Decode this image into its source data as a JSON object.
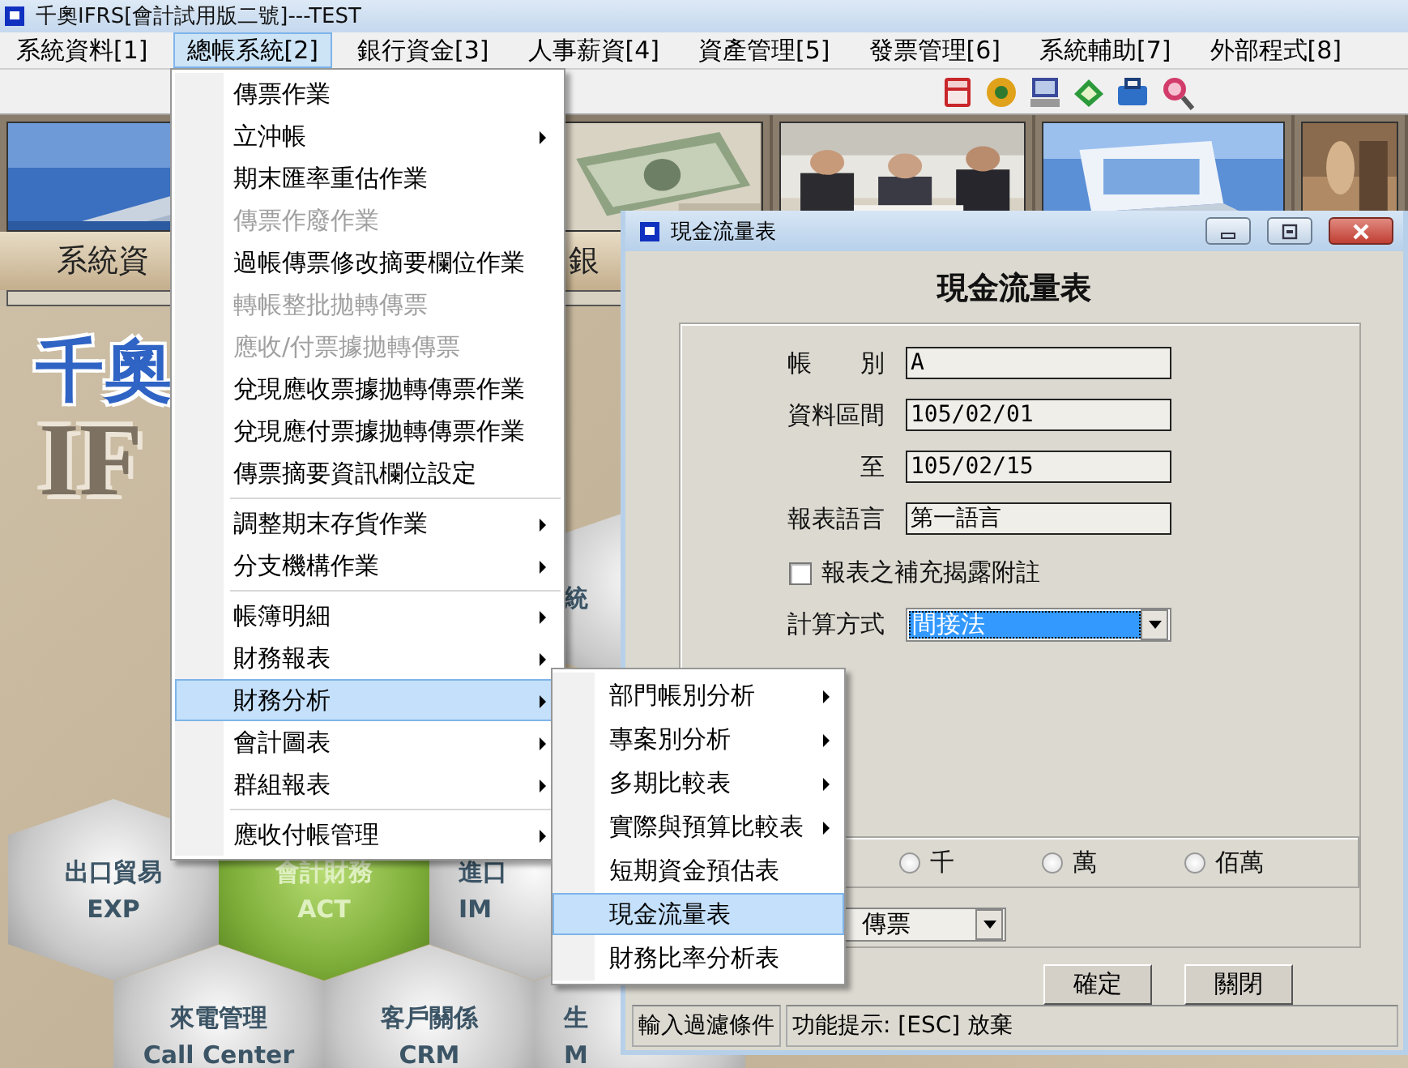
{
  "window": {
    "title": "千奧IFRS[會計試用版二號]---TEST"
  },
  "menu_bar": [
    {
      "label": "系統資料[1]",
      "selected": false
    },
    {
      "label": "總帳系統[2]",
      "selected": true
    },
    {
      "label": "銀行資金[3]",
      "selected": false
    },
    {
      "label": "人事薪資[4]",
      "selected": false
    },
    {
      "label": "資產管理[5]",
      "selected": false
    },
    {
      "label": "發票管理[6]",
      "selected": false
    },
    {
      "label": "系統輔助[7]",
      "selected": false
    },
    {
      "label": "外部程式[8]",
      "selected": false
    }
  ],
  "banner": {
    "labels": [
      "系統資",
      "銀"
    ]
  },
  "logo": {
    "name": "千奧",
    "subtitle": "IF"
  },
  "modules": [
    {
      "title": "統",
      "selected": false
    },
    {
      "title": "出口貿易",
      "code": "EXP",
      "selected": false
    },
    {
      "title": "會計財務",
      "code": "ACT",
      "selected": true
    },
    {
      "title": "進口",
      "code": "IM",
      "selected": false
    },
    {
      "title": "來電管理",
      "code": "Call Center",
      "selected": false
    },
    {
      "title": "客戶關係",
      "code": "CRM",
      "selected": false
    },
    {
      "title": "生",
      "code": "M",
      "selected": false
    }
  ],
  "menu": {
    "sections": [
      {
        "items": [
          {
            "label": "傳票作業",
            "has_submenu": false,
            "disabled": false,
            "selected": false
          },
          {
            "label": "立沖帳",
            "has_submenu": true,
            "disabled": false,
            "selected": false
          },
          {
            "label": "期末匯率重估作業",
            "has_submenu": false,
            "disabled": false,
            "selected": false
          },
          {
            "label": "傳票作廢作業",
            "has_submenu": false,
            "disabled": true,
            "selected": false
          },
          {
            "label": "過帳傳票修改摘要欄位作業",
            "has_submenu": false,
            "disabled": false,
            "selected": false
          },
          {
            "label": "轉帳整批拋轉傳票",
            "has_submenu": false,
            "disabled": true,
            "selected": false
          },
          {
            "label": "應收/付票據拋轉傳票",
            "has_submenu": false,
            "disabled": true,
            "selected": false
          },
          {
            "label": "兌現應收票據拋轉傳票作業",
            "has_submenu": false,
            "disabled": false,
            "selected": false
          },
          {
            "label": "兌現應付票據拋轉傳票作業",
            "has_submenu": false,
            "disabled": false,
            "selected": false
          },
          {
            "label": "傳票摘要資訊欄位設定",
            "has_submenu": false,
            "disabled": false,
            "selected": false
          }
        ]
      },
      {
        "items": [
          {
            "label": "調整期末存貨作業",
            "has_submenu": true,
            "disabled": false,
            "selected": false
          },
          {
            "label": "分支機構作業",
            "has_submenu": true,
            "disabled": false,
            "selected": false
          }
        ]
      },
      {
        "items": [
          {
            "label": "帳簿明細",
            "has_submenu": true,
            "disabled": false,
            "selected": false
          },
          {
            "label": "財務報表",
            "has_submenu": true,
            "disabled": false,
            "selected": false
          },
          {
            "label": "財務分析",
            "has_submenu": true,
            "disabled": false,
            "selected": true
          },
          {
            "label": "會計圖表",
            "has_submenu": true,
            "disabled": false,
            "selected": false
          },
          {
            "label": "群組報表",
            "has_submenu": true,
            "disabled": false,
            "selected": false
          }
        ]
      },
      {
        "items": [
          {
            "label": "應收付帳管理",
            "has_submenu": true,
            "disabled": false,
            "selected": false
          }
        ]
      }
    ]
  },
  "submenu": {
    "items": [
      {
        "label": "部門帳別分析",
        "has_submenu": true,
        "selected": false
      },
      {
        "label": "專案別分析",
        "has_submenu": true,
        "selected": false
      },
      {
        "label": "多期比較表",
        "has_submenu": true,
        "selected": false
      },
      {
        "label": "實際與預算比較表",
        "has_submenu": true,
        "selected": false
      },
      {
        "label": "短期資金預估表",
        "has_submenu": false,
        "selected": false
      },
      {
        "label": "現金流量表",
        "has_submenu": false,
        "selected": true
      },
      {
        "label": "財務比率分析表",
        "has_submenu": false,
        "selected": false
      }
    ]
  },
  "dialog": {
    "title": "現金流量表",
    "heading": "現金流量表",
    "fields": [
      {
        "label": "帳　　別",
        "value": "A"
      },
      {
        "label": "資料區間",
        "value": "105/02/01"
      },
      {
        "label": "至",
        "value": "105/02/15"
      },
      {
        "label": "報表語言",
        "value": "第一語言"
      }
    ],
    "checkbox": {
      "label": "報表之補充揭露附註",
      "checked": false
    },
    "method": {
      "label": "計算方式",
      "value": "間接法"
    },
    "units": [
      {
        "label": "千",
        "selected": false
      },
      {
        "label": "萬",
        "selected": false
      },
      {
        "label": "佰萬",
        "selected": false
      }
    ],
    "voucher_select": {
      "value": "傳票"
    },
    "buttons": [
      "確定",
      "關閉"
    ],
    "status_bar": [
      "輸入過濾條件",
      "功能提示: [ESC] 放棄"
    ]
  }
}
